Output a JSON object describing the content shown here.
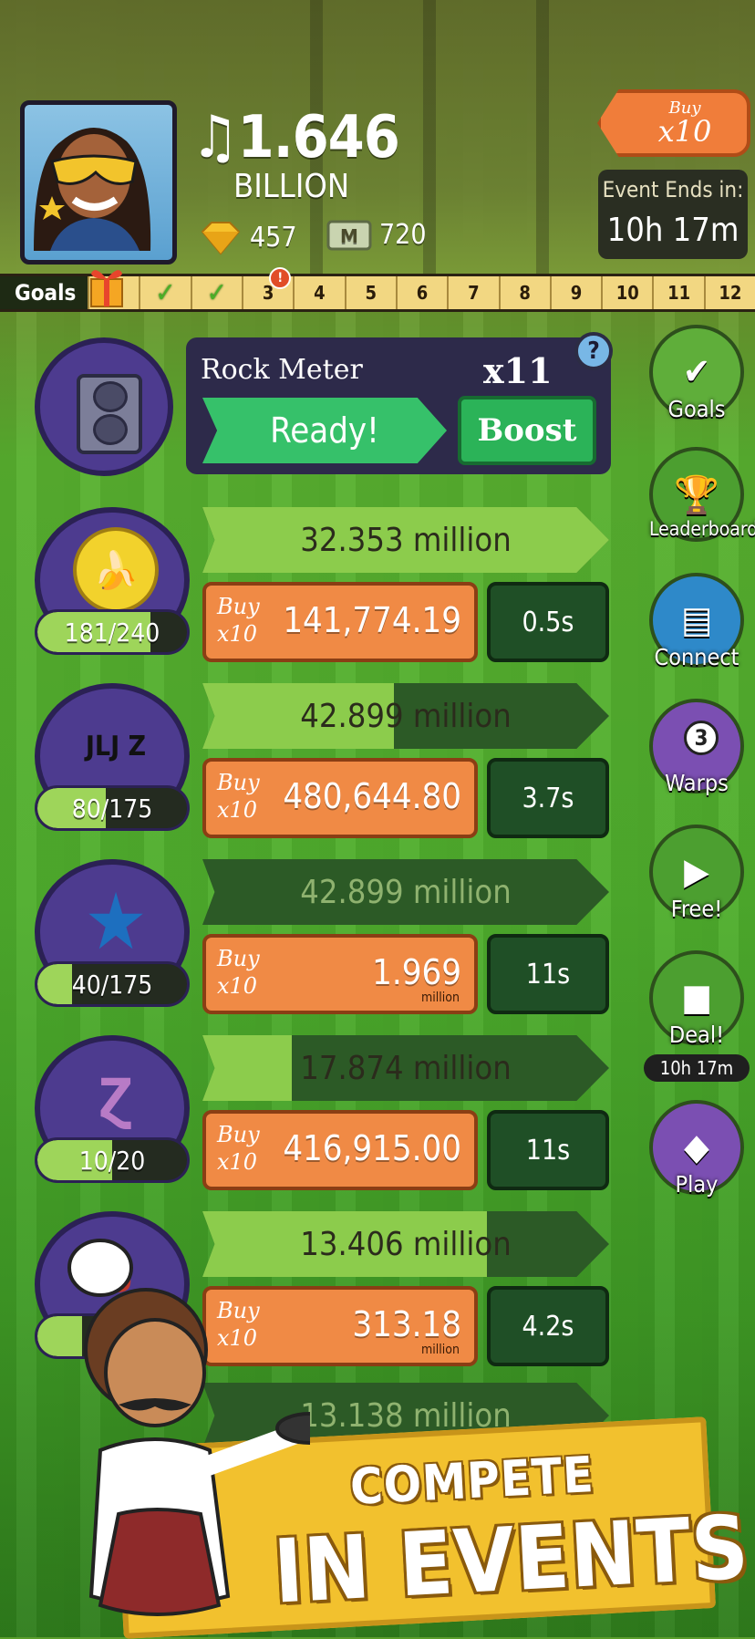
{
  "header": {
    "cash_symbol": "♫",
    "cash_value": "1.646",
    "cash_unit": "BILLION",
    "gems": "457",
    "megabucks": "720",
    "buy_tag_small": "Buy",
    "buy_tag_big": "x10",
    "event_label": "Event Ends in:",
    "event_time": "10h 17m"
  },
  "goals": {
    "label": "Goals",
    "cells": [
      "",
      "✓",
      "✓",
      "3",
      "4",
      "5",
      "6",
      "7",
      "8",
      "9",
      "10",
      "11",
      "12"
    ]
  },
  "rock_meter": {
    "title": "Rock Meter",
    "multiplier": "x11",
    "ready_label": "Ready!",
    "boost_label": "Boost",
    "help": "?"
  },
  "businesses": [
    {
      "icon": "banana-coin-icon",
      "glyph": "🍌",
      "progress_text": "181/240",
      "progress": 0.754,
      "revenue": "32.353 million",
      "revenue_fill": 1.0,
      "buy_small": "Buy",
      "buy_big": "x10",
      "price": "141,774.19",
      "price_unit": "",
      "time": "0.5s"
    },
    {
      "icon": "jljz-logo-icon",
      "glyph": "JLJ Z",
      "progress_text": "80/175",
      "progress": 0.457,
      "revenue": "42.899 million",
      "revenue_fill": 0.47,
      "buy_small": "Buy",
      "buy_big": "x10",
      "price": "480,644.80",
      "price_unit": "",
      "time": "3.7s"
    },
    {
      "icon": "star-icon",
      "glyph": "★",
      "progress_text": "40/175",
      "progress": 0.229,
      "revenue": "42.899 million",
      "revenue_fill": 0.0,
      "buy_small": "Buy",
      "buy_big": "x10",
      "price": "1.969",
      "price_unit": "million",
      "time": "11s"
    },
    {
      "icon": "symbol-icon",
      "glyph": "Ɀ",
      "progress_text": "10/20",
      "progress": 0.5,
      "revenue": "17.874 million",
      "revenue_fill": 0.22,
      "buy_small": "Buy",
      "buy_big": "x10",
      "price": "416,915.00",
      "price_unit": "",
      "time": "11s"
    },
    {
      "icon": "b-logo-icon",
      "glyph": "B",
      "progress_text": "",
      "progress": 0.3,
      "revenue": "13.406 million",
      "revenue_fill": 0.7,
      "buy_small": "Buy",
      "buy_big": "x10",
      "price": "313.18",
      "price_unit": "million",
      "time": "4.2s"
    }
  ],
  "partial_row": {
    "revenue": "13.138 million"
  },
  "side_buttons": [
    {
      "name": "goals",
      "icon": "checklist-icon",
      "label": "Goals"
    },
    {
      "name": "leaderboard",
      "icon": "trophy-icon",
      "label": "Leaderboard"
    },
    {
      "name": "connect",
      "icon": "cards-icon",
      "label": "Connect"
    },
    {
      "name": "warps",
      "icon": "warp-icon",
      "badge": "3",
      "label": "Warps"
    },
    {
      "name": "free",
      "icon": "tv-icon",
      "label": "Free!"
    },
    {
      "name": "deal",
      "icon": "gift-box-icon",
      "label": "Deal!"
    },
    {
      "name": "play",
      "icon": "juicer-icon",
      "label": "Play"
    }
  ],
  "deal_timer": "10h 17m",
  "promo": {
    "line1": "COMPETE",
    "line2": "IN EVENTS"
  },
  "colors": {
    "orange": "#f08a45",
    "green_bar": "#8ccc4c",
    "purple": "#4d3b8f",
    "gold": "#f2c12e"
  }
}
